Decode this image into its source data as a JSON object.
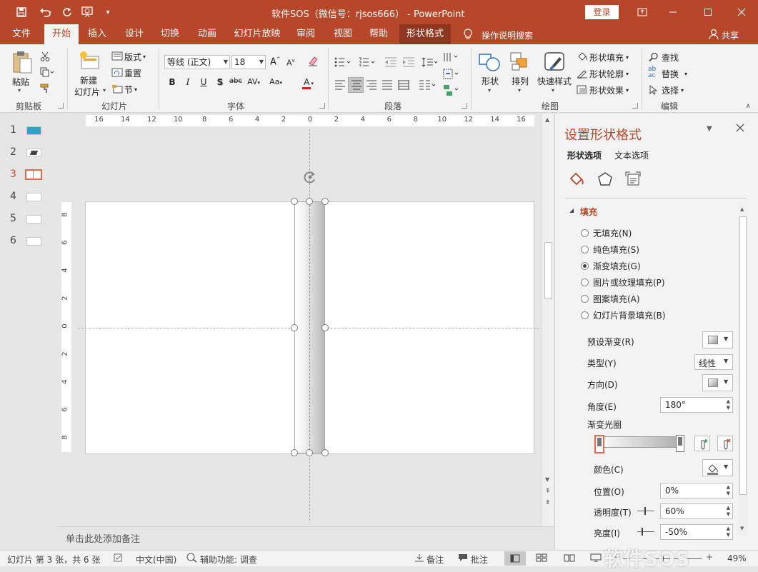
{
  "app": {
    "title": "软件SOS（微信号：rjsos666） - PowerPoint",
    "login": "登录",
    "share": "共享",
    "tell_me": "操作说明搜索"
  },
  "tabs": [
    "文件",
    "开始",
    "插入",
    "设计",
    "切换",
    "动画",
    "幻灯片放映",
    "审阅",
    "视图",
    "帮助",
    "形状格式"
  ],
  "ribbon": {
    "clipboard": {
      "paste": "粘贴",
      "label": "剪贴板"
    },
    "slides": {
      "new_slide_1": "新建",
      "new_slide_2": "幻灯片",
      "layout": "版式",
      "reset": "重置",
      "section": "节",
      "label": "幻灯片"
    },
    "font": {
      "name": "等线 (正文)",
      "size": "18",
      "label": "字体"
    },
    "paragraph": {
      "label": "段落"
    },
    "drawing": {
      "shapes": "形状",
      "arrange": "排列",
      "quick_styles": "快速样式",
      "fill": "形状填充",
      "outline": "形状轮廓",
      "effects": "形状效果",
      "label": "绘图"
    },
    "editing": {
      "find": "查找",
      "replace": "替换",
      "select": "选择",
      "label": "编辑"
    }
  },
  "ruler": {
    "h_ticks": [
      "16",
      "14",
      "12",
      "10",
      "8",
      "6",
      "4",
      "2",
      "0",
      "2",
      "4",
      "6",
      "8",
      "10",
      "12",
      "14",
      "16"
    ],
    "v_ticks": [
      "8",
      "6",
      "4",
      "2",
      "0",
      "2",
      "4",
      "6",
      "8"
    ]
  },
  "slides": [
    {
      "num": "1"
    },
    {
      "num": "2"
    },
    {
      "num": "3"
    },
    {
      "num": "4"
    },
    {
      "num": "5"
    },
    {
      "num": "6"
    }
  ],
  "notes": {
    "placeholder": "单击此处添加备注"
  },
  "pane": {
    "title": "设置形状格式",
    "tab_shape": "形状选项",
    "tab_text": "文本选项",
    "section_fill": "填充",
    "fill_options": [
      {
        "label": "无填充(N)",
        "selected": false
      },
      {
        "label": "纯色填充(S)",
        "selected": false
      },
      {
        "label": "渐变填充(G)",
        "selected": true
      },
      {
        "label": "图片或纹理填充(P)",
        "selected": false
      },
      {
        "label": "图案填充(A)",
        "selected": false
      },
      {
        "label": "幻灯片背景填充(B)",
        "selected": false
      }
    ],
    "preset_label": "预设渐变(R)",
    "type_label": "类型(Y)",
    "type_value": "线性",
    "direction_label": "方向(D)",
    "angle_label": "角度(E)",
    "angle_value": "180°",
    "stops_label": "渐变光圈",
    "color_label": "颜色(C)",
    "position_label": "位置(O)",
    "position_value": "0%",
    "transparency_label": "透明度(T)",
    "transparency_value": "60%",
    "brightness_label": "亮度(I)",
    "brightness_value": "-50%"
  },
  "status": {
    "slide_info": "幻灯片 第 3 张，共 6 张",
    "language": "中文(中国)",
    "accessibility": "辅助功能: 调查",
    "notes": "备注",
    "comments": "批注",
    "zoom": "49%",
    "watermark": "软件SOS"
  },
  "colors": {
    "accent": "#b7472a",
    "ribbon": "#f3f3f3",
    "canvas": "#e6e6e6"
  }
}
